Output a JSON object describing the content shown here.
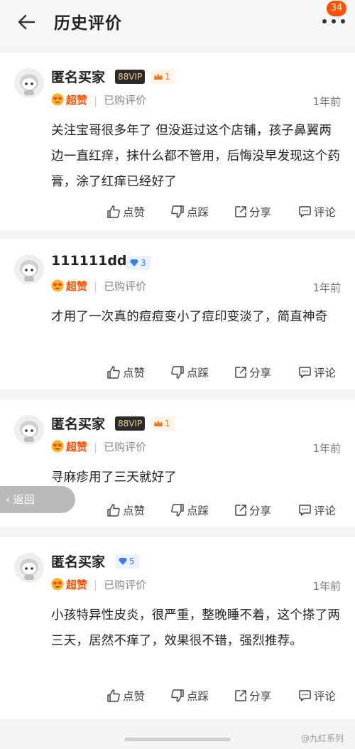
{
  "header": {
    "title": "历史评价",
    "badge_count": "34"
  },
  "return_label": "返回",
  "watermark": "@九红系列",
  "actions": {
    "like": "点赞",
    "dislike": "点踩",
    "share": "分享",
    "comment": "评论"
  },
  "reviews": [
    {
      "username": "匿名买家",
      "vip_tag": "88VIP",
      "level": "1",
      "level_icon": "crown-icon",
      "rating_label": "超赞",
      "purchased_label": "已购评价",
      "time": "1年前",
      "content": "关注宝哥很多年了 但没逛过这个店铺，孩子鼻翼两边一直红痒，抹什么都不管用，后悔没早发现这个药膏，涂了红痒已经好了"
    },
    {
      "username": "111111dd",
      "vip_tag": "",
      "level": "3",
      "level_icon": "diamond-icon",
      "rating_label": "超赞",
      "purchased_label": "已购评价",
      "time": "1年前",
      "content": "才用了一次真的痘痘变小了痘印变淡了，简直神奇"
    },
    {
      "username": "匿名买家",
      "vip_tag": "88VIP",
      "level": "1",
      "level_icon": "crown-icon",
      "rating_label": "超赞",
      "purchased_label": "已购评价",
      "time": "1年前",
      "content": "寻麻疹用了三天就好了"
    },
    {
      "username": "匿名买家",
      "vip_tag": "",
      "level": "5",
      "level_icon": "diamond-icon",
      "rating_label": "超赞",
      "purchased_label": "已购评价",
      "time": "1年前",
      "content": "小孩特异性皮炎，很严重，整晚睡不着，这个搽了两三天，居然不痒了，效果很不错，强烈推荐。"
    }
  ],
  "colors": {
    "accent": "#ff5000",
    "vip_bg": "#2b2b2b",
    "vip_text": "#f1cf8e",
    "crown": "#e77b1f",
    "diamond": "#3b7bea"
  }
}
